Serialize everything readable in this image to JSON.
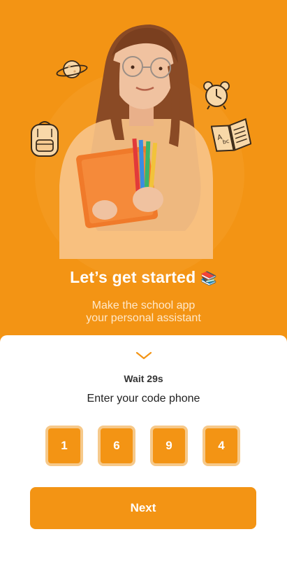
{
  "colors": {
    "accent": "#F39414",
    "code_border": "#F6C98A",
    "sheet": "#FFFFFF"
  },
  "hero": {
    "illustration": "student-holding-books",
    "icons": [
      "planet-icon",
      "alarm-clock-icon",
      "backpack-icon",
      "open-book-icon"
    ]
  },
  "headline": {
    "text": "Let’s get started",
    "emoji": "📚"
  },
  "subline": {
    "line1": "Make the school app",
    "line2": "your personal assistant"
  },
  "verify": {
    "wait_text": "Wait 29s",
    "instruction": "Enter your code phone",
    "digits": [
      "1",
      "6",
      "9",
      "4"
    ]
  },
  "actions": {
    "next_label": "Next"
  }
}
